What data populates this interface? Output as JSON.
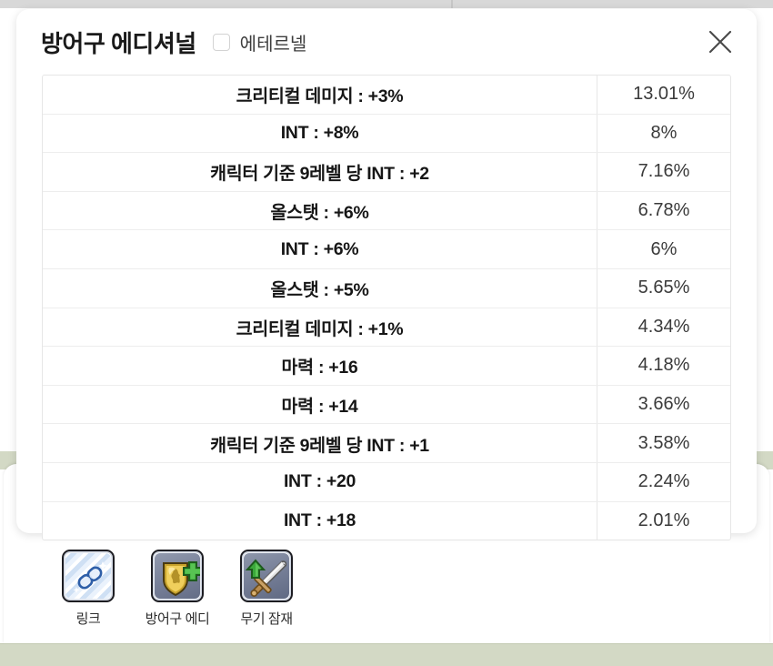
{
  "modal": {
    "title": "방어구 에디셔널",
    "eternal_label": "에테르넬",
    "eternal_checked": false,
    "close_icon": "close-x-icon"
  },
  "table": {
    "rows": [
      {
        "name": "크리티컬 데미지 : +3%",
        "value": "13.01%"
      },
      {
        "name": "INT : +8%",
        "value": "8%"
      },
      {
        "name": "캐릭터 기준 9레벨 당 INT : +2",
        "value": "7.16%"
      },
      {
        "name": "올스탯 : +6%",
        "value": "6.78%"
      },
      {
        "name": "INT : +6%",
        "value": "6%"
      },
      {
        "name": "올스탯 : +5%",
        "value": "5.65%"
      },
      {
        "name": "크리티컬 데미지 : +1%",
        "value": "4.34%"
      },
      {
        "name": "마력 : +16",
        "value": "4.18%"
      },
      {
        "name": "마력 : +14",
        "value": "3.66%"
      },
      {
        "name": "캐릭터 기준 9레벨 당 INT : +1",
        "value": "3.58%"
      },
      {
        "name": "INT : +20",
        "value": "2.24%"
      },
      {
        "name": "INT : +18",
        "value": "2.01%"
      }
    ]
  },
  "toolbar": {
    "items": [
      {
        "label": "링크",
        "icon": "chain-link-icon"
      },
      {
        "label": "방어구 에디",
        "icon": "gold-shield-plus-icon"
      },
      {
        "label": "무기 잠재",
        "icon": "sword-up-arrow-icon"
      }
    ]
  },
  "colors": {
    "background": "#ffffff",
    "strip_top": "#d8d8d8",
    "strip_bottom": "#d3d9c5",
    "text_primary": "#161616",
    "text_value": "#3a3a3a",
    "border": "#e6e6e6"
  }
}
